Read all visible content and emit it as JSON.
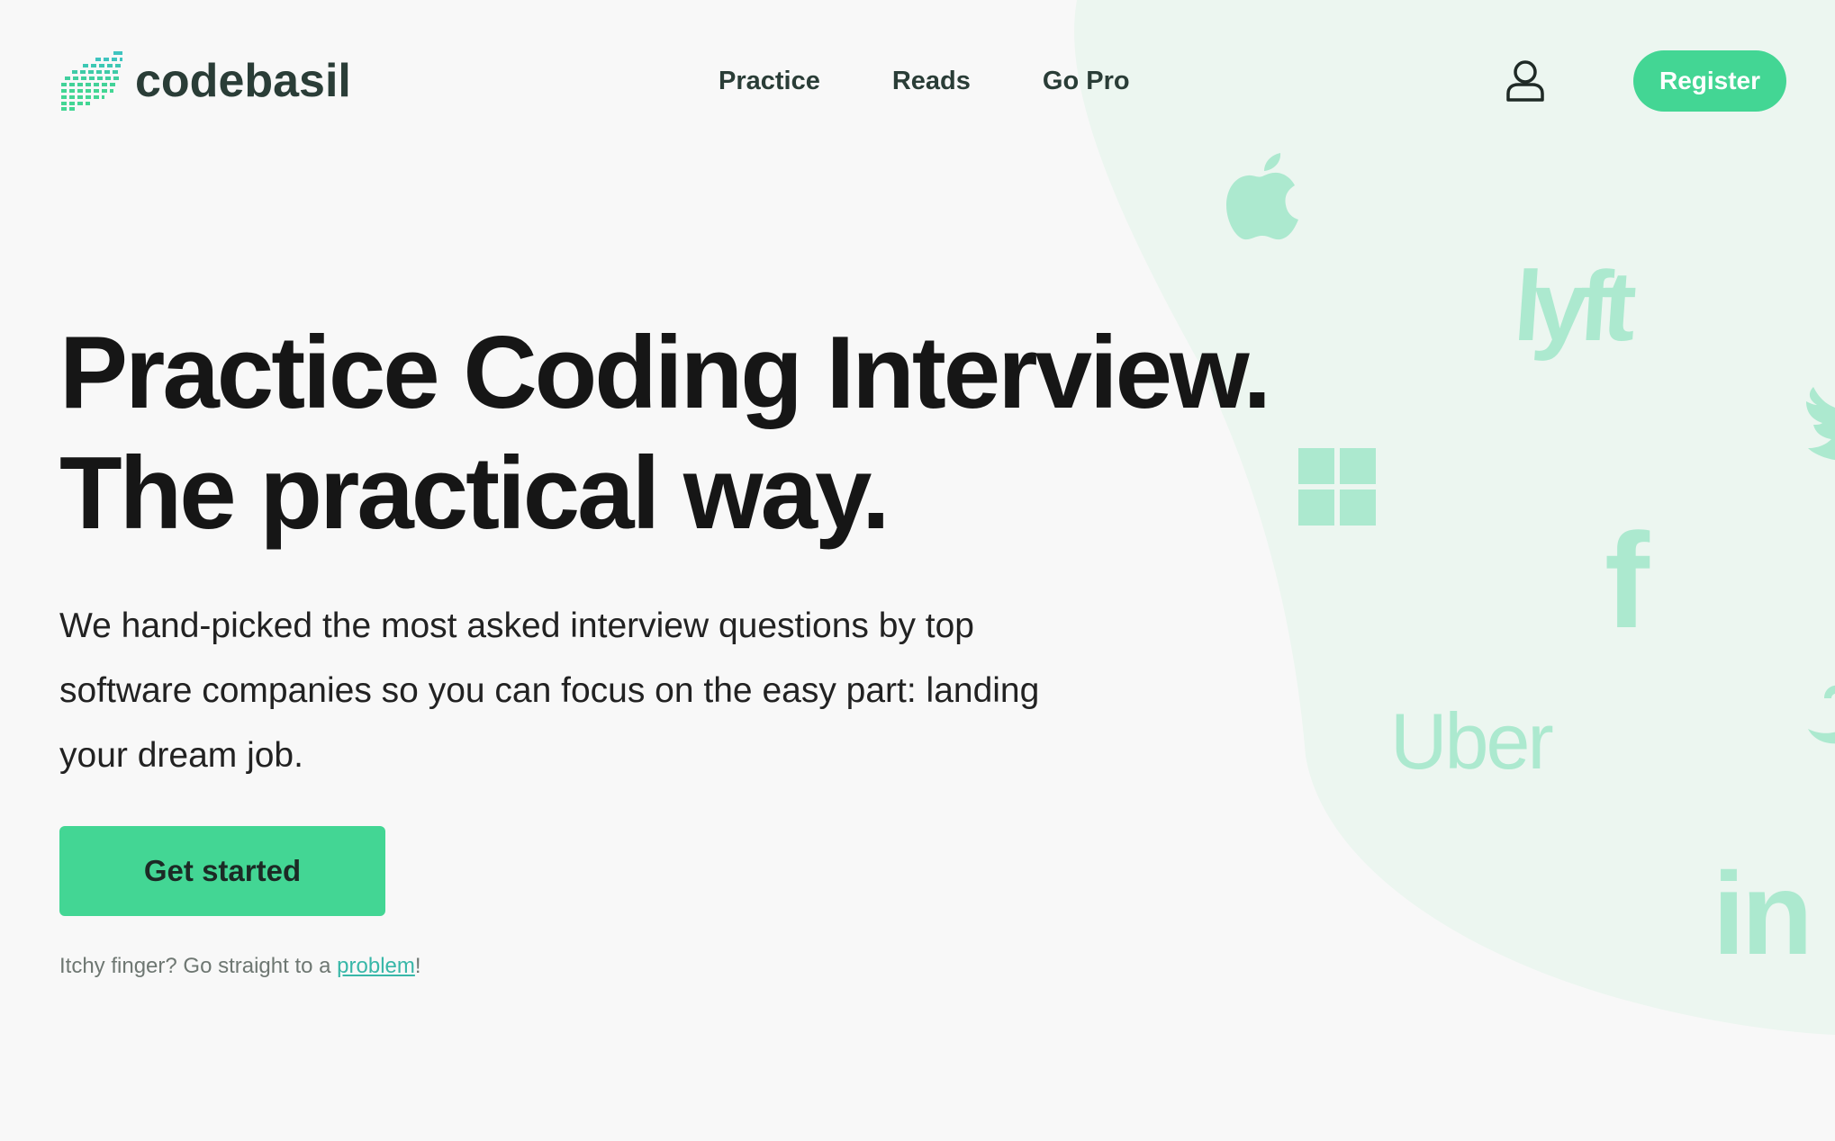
{
  "brand": {
    "name": "codebasil",
    "accent_color": "#43d694",
    "text_color": "#2a3d37",
    "logo_icon": "stacked-dashes-logo-icon"
  },
  "nav": {
    "items": [
      {
        "label": "Practice"
      },
      {
        "label": "Reads"
      },
      {
        "label": "Go Pro"
      }
    ]
  },
  "header": {
    "user_icon": "user-icon",
    "register_label": "Register"
  },
  "hero": {
    "title_line1": "Practice Coding Interview.",
    "title_line2": "The practical way.",
    "description": "We hand-picked the most asked interview questions by top software companies so you can focus on the easy part: landing your dream job.",
    "cta_label": "Get started",
    "hint_prefix": "Itchy finger? Go straight to a ",
    "hint_link": "problem",
    "hint_suffix": "!"
  },
  "companies": {
    "icons": [
      "apple-icon",
      "windows-icon",
      "twitter-icon",
      "amazon-icon"
    ],
    "lyft": "lyft",
    "facebook": "f",
    "uber": "Uber",
    "linkedin": "in",
    "logo_color": "#ace9cf",
    "blob_color": "#ecf6f0"
  }
}
